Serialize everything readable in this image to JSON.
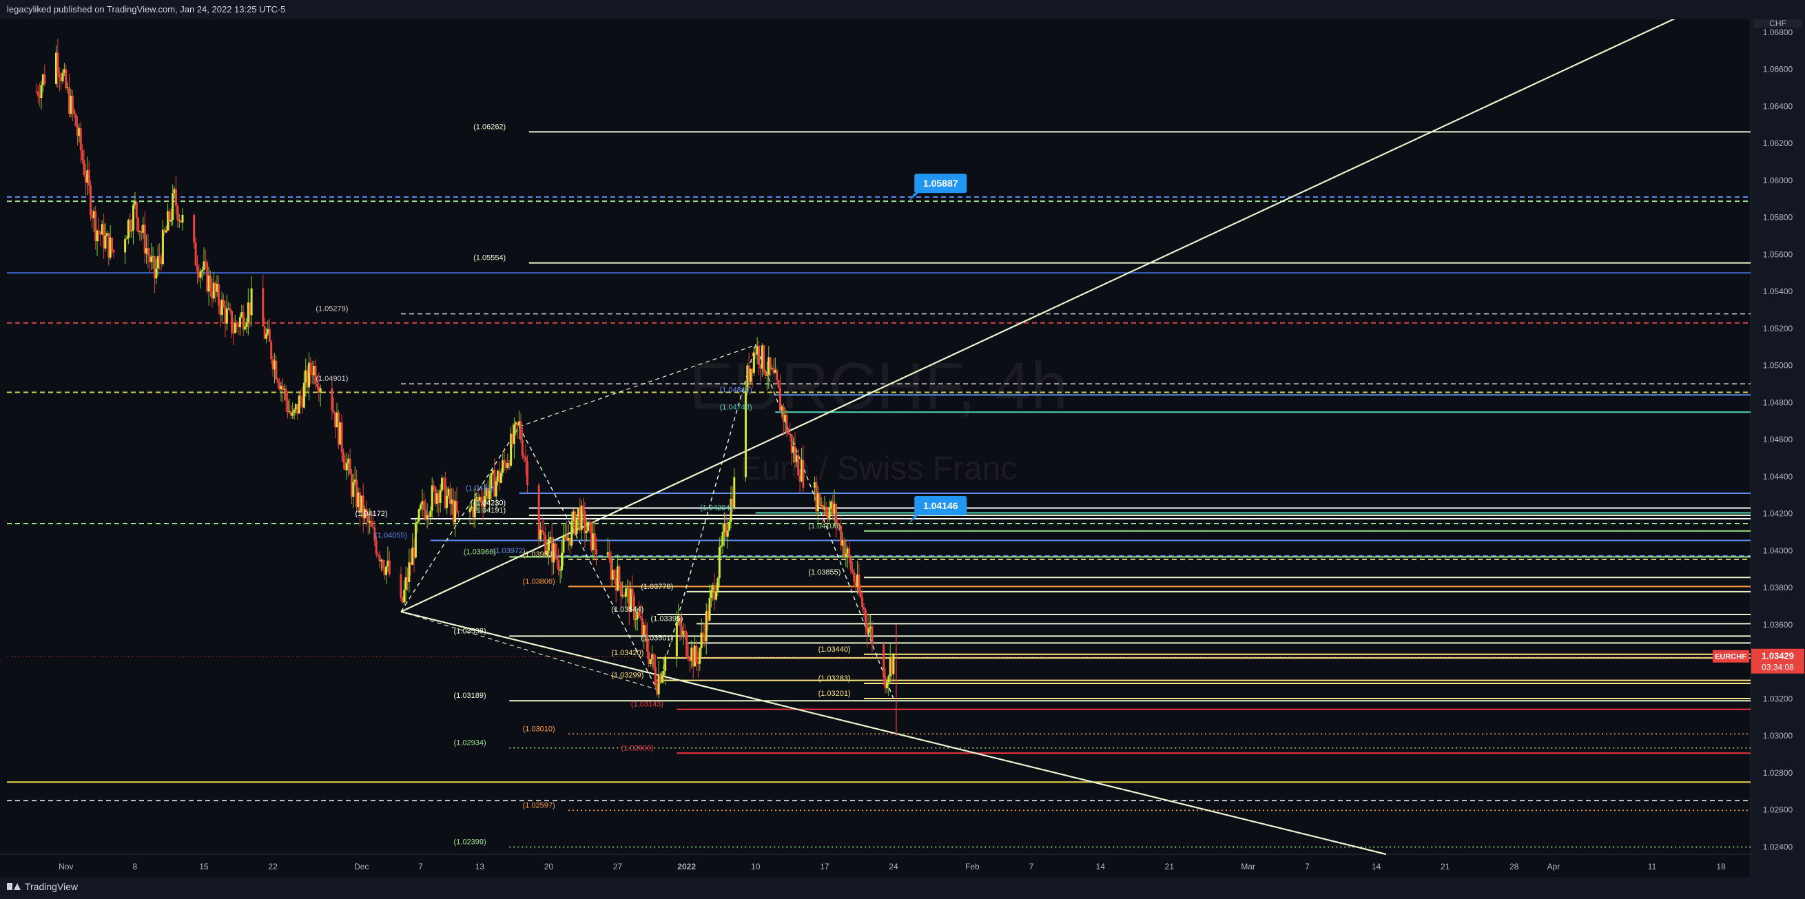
{
  "header": {
    "publisher_text": "legacyliked published on TradingView.com, Jan 24, 2022 13:25 UTC-5"
  },
  "footer": {
    "brand": "TradingView"
  },
  "chart_data": {
    "type": "candlestick",
    "symbol_watermark": "EURCHF, 4h",
    "description_watermark": "Euro / Swiss Franc",
    "currency": "CHF",
    "ylim": [
      1.0236,
      1.0687
    ],
    "y_ticks": [
      "1.06800",
      "1.06600",
      "1.06400",
      "1.06200",
      "1.06000",
      "1.05800",
      "1.05600",
      "1.05400",
      "1.05200",
      "1.05000",
      "1.04800",
      "1.04600",
      "1.04400",
      "1.04200",
      "1.04000",
      "1.03800",
      "1.03600",
      "1.03400",
      "1.03200",
      "1.03000",
      "1.02800",
      "1.02600",
      "1.02400"
    ],
    "x_ticks": [
      {
        "label": "Nov",
        "x": "2021-11-01"
      },
      {
        "label": "8",
        "x": "2021-11-08"
      },
      {
        "label": "15",
        "x": "2021-11-15"
      },
      {
        "label": "22",
        "x": "2021-11-22"
      },
      {
        "label": "Dec",
        "x": "2021-12-01"
      },
      {
        "label": "7",
        "x": "2021-12-07"
      },
      {
        "label": "13",
        "x": "2021-12-13"
      },
      {
        "label": "20",
        "x": "2021-12-20"
      },
      {
        "label": "27",
        "x": "2021-12-27"
      },
      {
        "label": "2022",
        "x": "2022-01-03"
      },
      {
        "label": "10",
        "x": "2022-01-10"
      },
      {
        "label": "17",
        "x": "2022-01-17"
      },
      {
        "label": "24",
        "x": "2022-01-24"
      },
      {
        "label": "Feb",
        "x": "2022-02-01"
      },
      {
        "label": "7",
        "x": "2022-02-07"
      },
      {
        "label": "14",
        "x": "2022-02-14"
      },
      {
        "label": "21",
        "x": "2022-02-21"
      },
      {
        "label": "Mar",
        "x": "2022-03-01"
      },
      {
        "label": "7",
        "x": "2022-03-07"
      },
      {
        "label": "14",
        "x": "2022-03-14"
      },
      {
        "label": "21",
        "x": "2022-03-21"
      },
      {
        "label": "28",
        "x": "2022-03-28"
      },
      {
        "label": "Apr",
        "x": "2022-04-01"
      },
      {
        "label": "11",
        "x": "2022-04-11"
      },
      {
        "label": "18",
        "x": "2022-04-18"
      }
    ],
    "price_path": [
      [
        "2021-10-29",
        1.0648
      ],
      [
        "2021-10-31",
        1.0668
      ],
      [
        "2021-11-02",
        1.063
      ],
      [
        "2021-11-04",
        1.0575
      ],
      [
        "2021-11-06",
        1.056
      ],
      [
        "2021-11-08",
        1.0585
      ],
      [
        "2021-11-10",
        1.0548
      ],
      [
        "2021-11-12",
        1.059
      ],
      [
        "2021-11-14",
        1.056
      ],
      [
        "2021-11-16",
        1.054
      ],
      [
        "2021-11-18",
        1.052
      ],
      [
        "2021-11-20",
        1.0535
      ],
      [
        "2021-11-22",
        1.0505
      ],
      [
        "2021-11-24",
        1.047
      ],
      [
        "2021-11-26",
        1.05
      ],
      [
        "2021-11-28",
        1.048
      ],
      [
        "2021-11-30",
        1.0435
      ],
      [
        "2021-12-02",
        1.041
      ],
      [
        "2021-12-04",
        1.0385
      ],
      [
        "2021-12-05",
        1.0368
      ],
      [
        "2021-12-07",
        1.042
      ],
      [
        "2021-12-09",
        1.0435
      ],
      [
        "2021-12-11",
        1.0415
      ],
      [
        "2021-12-13",
        1.0428
      ],
      [
        "2021-12-15",
        1.044
      ],
      [
        "2021-12-17",
        1.0467
      ],
      [
        "2021-12-19",
        1.041
      ],
      [
        "2021-12-21",
        1.0395
      ],
      [
        "2021-12-23",
        1.042
      ],
      [
        "2021-12-25",
        1.04
      ],
      [
        "2021-12-27",
        1.0385
      ],
      [
        "2021-12-29",
        1.0365
      ],
      [
        "2021-12-31",
        1.033
      ],
      [
        "2022-01-02",
        1.036
      ],
      [
        "2022-01-04",
        1.034
      ],
      [
        "2022-01-06",
        1.0385
      ],
      [
        "2022-01-08",
        1.044
      ],
      [
        "2022-01-09",
        1.049
      ],
      [
        "2022-01-10",
        1.051
      ],
      [
        "2022-01-12",
        1.049
      ],
      [
        "2022-01-14",
        1.045
      ],
      [
        "2022-01-16",
        1.043
      ],
      [
        "2022-01-18",
        1.042
      ],
      [
        "2022-01-20",
        1.0385
      ],
      [
        "2022-01-22",
        1.035
      ],
      [
        "2022-01-23",
        1.033
      ],
      [
        "2022-01-24",
        1.0343
      ]
    ],
    "last_price": {
      "symbol": "EURCHF",
      "value": "1.03429",
      "countdown": "03:34:08"
    },
    "callouts": [
      {
        "label": "1.05887",
        "price": 1.05887,
        "x": "2022-01-25"
      },
      {
        "label": "1.04146",
        "price": 1.04146,
        "x": "2022-01-25"
      }
    ],
    "levels": [
      {
        "label": "(1.06262)",
        "price": 1.06262,
        "color": "#e8f5d0",
        "style": "solid",
        "x_from": "2021-12-18",
        "text_x": "2021-12-14"
      },
      {
        "label": "(1.05554)",
        "price": 1.05554,
        "color": "#e8f5d0",
        "style": "solid",
        "x_from": "2021-12-18",
        "text_x": "2021-12-14"
      },
      {
        "label": "(1.05279)",
        "price": 1.05279,
        "color": "#c8c8c8",
        "style": "dashed",
        "x_from": "2021-12-05",
        "text_x": "2021-11-28"
      },
      {
        "label": "(1.04901)",
        "price": 1.04901,
        "color": "#c8c8c8",
        "style": "dashed",
        "x_from": "2021-12-05",
        "text_x": "2021-11-28"
      },
      {
        "label": "(1.04191)",
        "price": 1.04191,
        "color": "#e8f5d0",
        "style": "solid",
        "x_from": "2021-12-18",
        "text_x": "2021-12-14"
      },
      {
        "label": "(1.04172)",
        "price": 1.04172,
        "color": "#ffffff",
        "style": "solid",
        "x_from": "2021-12-06",
        "text_x": "2021-12-02"
      },
      {
        "label": "(1.03972)",
        "price": 1.03972,
        "color": "#5b8def",
        "style": "dashed",
        "x_from": "2021-12-20",
        "text_x": "2021-12-16"
      },
      {
        "label": "(1.03953)",
        "price": 1.03953,
        "color": "#ffe680",
        "style": "dashed",
        "x_from": "2021-12-22",
        "text_x": "2021-12-19"
      },
      {
        "label": "(1.03966)",
        "price": 1.03966,
        "color": "#9be38a",
        "style": "solid",
        "x_from": "2021-12-16",
        "text_x": "2021-12-13"
      },
      {
        "label": "(1.03806)",
        "price": 1.03806,
        "color": "#ff9f43",
        "style": "solid",
        "x_from": "2021-12-22",
        "text_x": "2021-12-19"
      },
      {
        "label": "(1.03778)",
        "price": 1.03778,
        "color": "#e8f5d0",
        "style": "solid",
        "x_from": "2022-01-03",
        "text_x": "2021-12-31"
      },
      {
        "label": "(1.03544)",
        "price": 1.03655,
        "color": "#e8f5d0",
        "style": "solid",
        "x_from": "2021-12-31",
        "text_x": "2021-12-28"
      },
      {
        "label": "(1.03395)",
        "price": 1.03605,
        "color": "#e8f5d0",
        "style": "solid",
        "x_from": "2022-01-04",
        "text_x": "2022-01-01"
      },
      {
        "label": "(1.03538)",
        "price": 1.03538,
        "color": "#e8f5d0",
        "style": "solid",
        "x_from": "2021-12-16",
        "text_x": "2021-12-12"
      },
      {
        "label": "(1.03501)",
        "price": 1.03501,
        "color": "#e8f5d0",
        "style": "solid",
        "x_from": "2022-01-03",
        "text_x": "2021-12-31"
      },
      {
        "label": "(1.03440)",
        "price": 1.0344,
        "color": "#ffe680",
        "style": "solid",
        "x_from": "2022-01-21",
        "text_x": "2022-01-18"
      },
      {
        "label": "(1.03420)",
        "price": 1.0342,
        "color": "#ffe680",
        "style": "solid",
        "x_from": "2021-12-31",
        "text_x": "2021-12-28"
      },
      {
        "label": "(1.03283)",
        "price": 1.03283,
        "color": "#ffe680",
        "style": "solid",
        "x_from": "2022-01-21",
        "text_x": "2022-01-18"
      },
      {
        "label": "(1.03299)",
        "price": 1.03299,
        "color": "#ffe680",
        "style": "solid",
        "x_from": "2021-12-31",
        "text_x": "2021-12-28"
      },
      {
        "label": "(1.03201)",
        "price": 1.03201,
        "color": "#ffe680",
        "style": "solid",
        "x_from": "2022-01-21",
        "text_x": "2022-01-18"
      },
      {
        "label": "(1.03189)",
        "price": 1.03189,
        "color": "#e8f5d0",
        "style": "solid",
        "x_from": "2021-12-16",
        "text_x": "2021-12-12"
      },
      {
        "label": "(1.03143)",
        "price": 1.03143,
        "color": "#f23645",
        "style": "solid",
        "x_from": "2022-01-02",
        "text_x": "2021-12-30"
      },
      {
        "label": "(1.03010)",
        "price": 1.0301,
        "color": "#ff9f43",
        "style": "dotted",
        "x_from": "2021-12-22",
        "text_x": "2021-12-19"
      },
      {
        "label": "(1.02934)",
        "price": 1.02934,
        "color": "#9be38a",
        "style": "dotted",
        "x_from": "2021-12-16",
        "text_x": "2021-12-12"
      },
      {
        "label": "(1.02906)",
        "price": 1.02906,
        "color": "#f23645",
        "style": "solid",
        "x_from": "2022-01-02",
        "text_x": "2021-12-29"
      },
      {
        "label": "(1.02597)",
        "price": 1.02597,
        "color": "#ff9f43",
        "style": "dotted",
        "x_from": "2021-12-22",
        "text_x": "2021-12-19"
      },
      {
        "label": "(1.02399)",
        "price": 1.02399,
        "color": "#9be38a",
        "style": "dotted",
        "x_from": "2021-12-16",
        "text_x": "2021-12-12"
      },
      {
        "label": "(1.04204)",
        "price": 1.04204,
        "color": "#4ed5ba",
        "style": "solid",
        "x_from": "2022-01-10",
        "text_x": "2022-01-06"
      },
      {
        "label": "(1.04748)",
        "price": 1.04748,
        "color": "#4ed5ba",
        "style": "solid",
        "x_from": "2022-01-12",
        "text_x": "2022-01-08"
      },
      {
        "label": "(1.04841)",
        "price": 1.04841,
        "color": "#5b8def",
        "style": "solid",
        "x_from": "2022-01-12",
        "text_x": "2022-01-08"
      },
      {
        "label": "(1.04106)",
        "price": 1.04106,
        "color": "#9be38a",
        "style": "solid",
        "x_from": "2022-01-21",
        "text_x": "2022-01-17"
      },
      {
        "label": "(1.04230)",
        "price": 1.0423,
        "color": "#ffffff",
        "style": "solid",
        "x_from": "2021-12-18",
        "text_x": "2021-12-14"
      },
      {
        "label": "(1.03855)",
        "price": 1.03855,
        "color": "#e8f5d0",
        "style": "solid",
        "x_from": "2022-01-21",
        "text_x": "2022-01-17"
      },
      {
        "label": "(1.0431)",
        "price": 1.0431,
        "color": "#5b8def",
        "style": "solid",
        "x_from": "2021-12-17",
        "text_x": "2021-12-13"
      },
      {
        "label": "(1.04055)",
        "price": 1.04055,
        "color": "#5b8def",
        "style": "solid",
        "x_from": "2021-12-08",
        "text_x": "2021-12-04"
      }
    ],
    "full_width_lines": [
      {
        "price": 1.05887,
        "color": "#9be38a",
        "style": "dashed"
      },
      {
        "price": 1.0591,
        "color": "#5b8def",
        "style": "dashed"
      },
      {
        "price": 1.055,
        "color": "#3a62c8",
        "style": "solid"
      },
      {
        "price": 1.0523,
        "color": "#d9434d",
        "style": "dashed"
      },
      {
        "price": 1.04855,
        "color": "#d6d64a",
        "style": "dashed"
      },
      {
        "price": 1.04146,
        "color": "#9be38a",
        "style": "dashed"
      },
      {
        "price": 1.0275,
        "color": "#f0d250",
        "style": "solid"
      },
      {
        "price": 1.0265,
        "color": "#c8c8c8",
        "style": "dashed"
      }
    ],
    "trendlines": [
      {
        "from": [
          "2021-12-05",
          1.0367
        ],
        "to": [
          "2022-04-18",
          1.0699
        ],
        "color": "#e8f5d0"
      },
      {
        "from": [
          "2021-12-05",
          1.0367
        ],
        "to": [
          "2022-03-15",
          1.0236
        ],
        "color": "#e8f5d0"
      }
    ],
    "zigzag": [
      [
        "2021-12-05",
        1.0367
      ],
      [
        "2021-12-17",
        1.0467
      ],
      [
        "2021-12-31",
        1.0325
      ],
      [
        "2022-01-10",
        1.0511
      ],
      [
        "2022-01-24",
        1.032
      ]
    ]
  }
}
